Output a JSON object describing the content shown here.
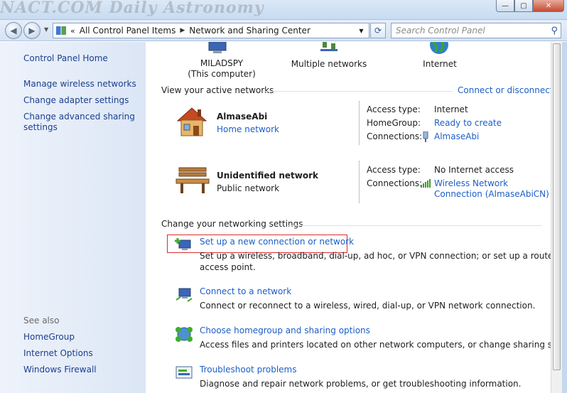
{
  "titlebar": {
    "watermark": "NACT.COM Daily Astronomy"
  },
  "address": {
    "crumbs": [
      "All Control Panel Items",
      "Network and Sharing Center"
    ],
    "search_placeholder": "Search Control Panel"
  },
  "sidebar": {
    "home": "Control Panel Home",
    "links": [
      "Manage wireless networks",
      "Change adapter settings",
      "Change advanced sharing settings"
    ],
    "see_also_label": "See also",
    "see_also": [
      "HomeGroup",
      "Internet Options",
      "Windows Firewall"
    ]
  },
  "network_map": {
    "computer_name": "MILADSPY",
    "computer_sub": "(This computer)",
    "middle": "Multiple networks",
    "internet": "Internet"
  },
  "active_networks": {
    "heading": "View your active networks",
    "connect_link": "Connect or disconnect",
    "networks": [
      {
        "name": "AlmaseAbi",
        "type": "Home network",
        "access_type_label": "Access type:",
        "access_type": "Internet",
        "homegroup_label": "HomeGroup:",
        "homegroup": "Ready to create",
        "connections_label": "Connections:",
        "connection": "AlmaseAbi"
      },
      {
        "name": "Unidentified network",
        "type": "Public network",
        "access_type_label": "Access type:",
        "access_type": "No Internet access",
        "connections_label": "Connections:",
        "connection_line1": "Wireless Network",
        "connection_line2": "Connection (AlmaseAbiCN)"
      }
    ]
  },
  "settings": {
    "heading": "Change your networking settings",
    "tasks": [
      {
        "title": "Set up a new connection or network",
        "desc1": "Set up a wireless, broadband, dial-up, ad hoc, or VPN connection; or set up a router or",
        "desc2": "access point."
      },
      {
        "title": "Connect to a network",
        "desc1": "Connect or reconnect to a wireless, wired, dial-up, or VPN network connection."
      },
      {
        "title": "Choose homegroup and sharing options",
        "desc1": "Access files and printers located on other network computers, or change sharing settings."
      },
      {
        "title": "Troubleshoot problems",
        "desc1": "Diagnose and repair network problems, or get troubleshooting information."
      }
    ]
  }
}
